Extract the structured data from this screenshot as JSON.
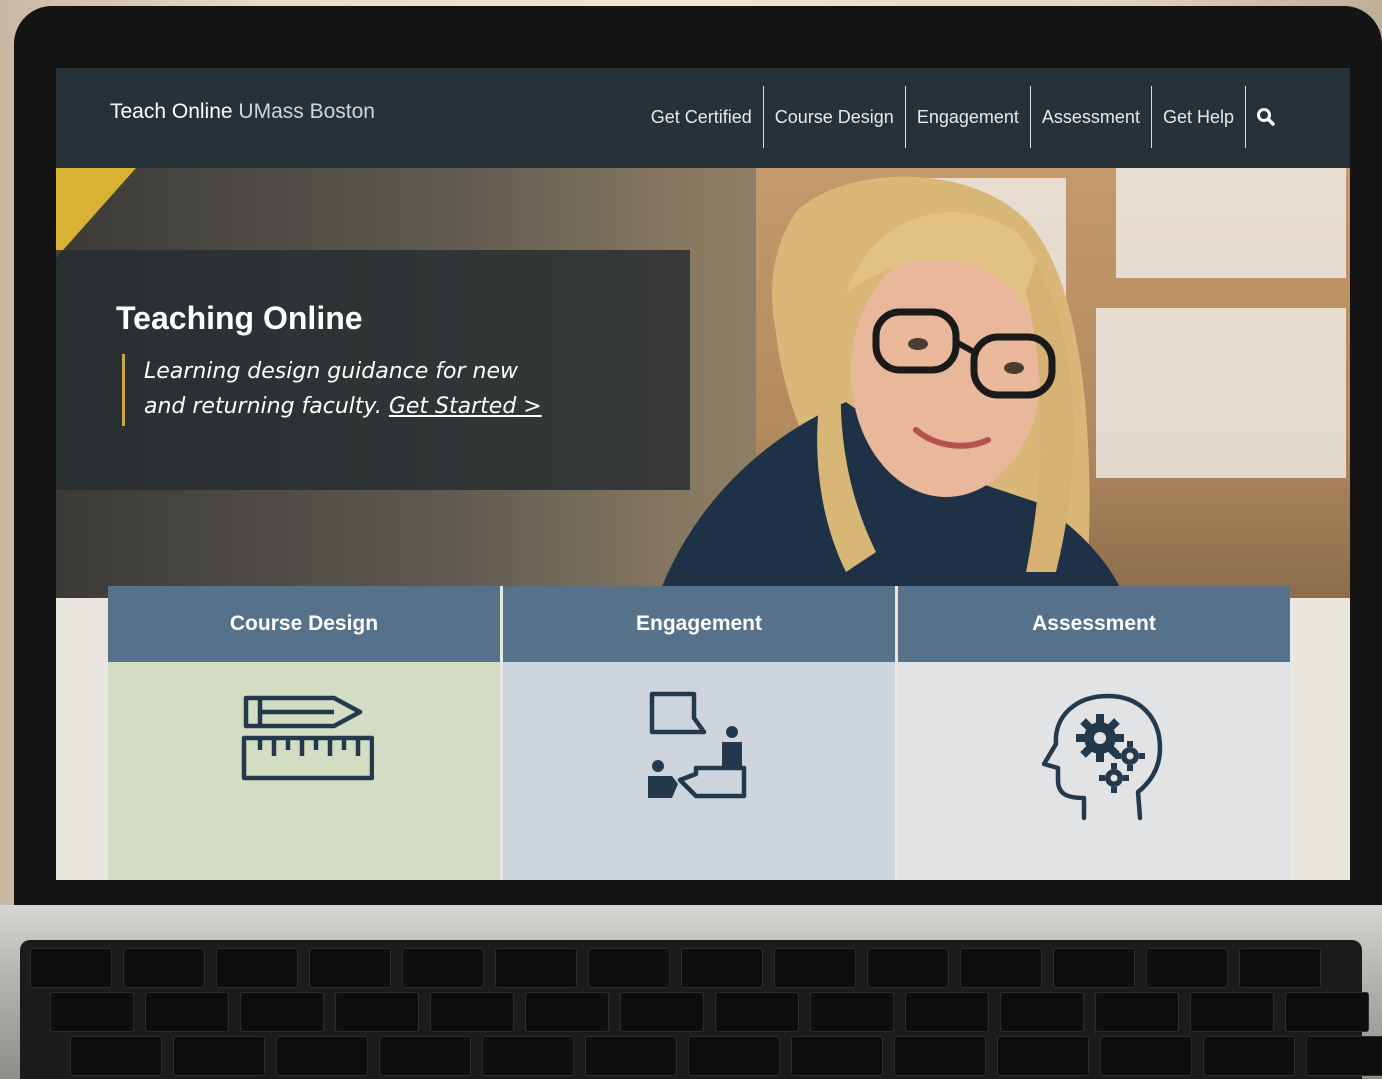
{
  "nav": {
    "brand_strong": "Teach Online",
    "brand_light": "UMass Boston",
    "links": [
      "Get Certified",
      "Course Design",
      "Engagement",
      "Assessment",
      "Get Help"
    ],
    "search_icon": "search-icon"
  },
  "hero": {
    "title": "Teaching Online",
    "tagline": "Learning design guidance for new and returning faculty.",
    "link": "Get Started >"
  },
  "cards": [
    {
      "title": "Course Design",
      "icon": "pencil-ruler-icon"
    },
    {
      "title": "Engagement",
      "icon": "discussion-icon"
    },
    {
      "title": "Assessment",
      "icon": "head-gears-icon"
    }
  ],
  "colors": {
    "nav_bg": "#263238",
    "card_header": "#56728a",
    "accent_gold": "#c8a64a",
    "icon": "#243a4c"
  }
}
